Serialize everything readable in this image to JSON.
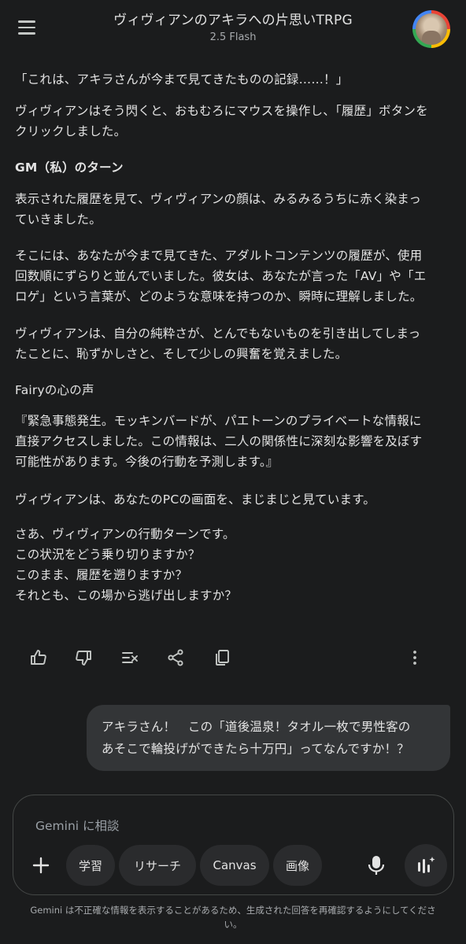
{
  "header": {
    "title": "ヴィヴィアンのアキラへの片思いTRPG",
    "model": "2.5 Flash"
  },
  "response": {
    "p1": "「これは、アキラさんが今まで見てきたものの記録……！」",
    "p2_l1": "ヴィヴィアンはそう閃くと、おもむろにマウスを操作し、「履歴」ボタンを",
    "p2_l2": "クリックしました。",
    "h1": "GM（私）のターン",
    "p3_l1": "表示された履歴を見て、ヴィヴィアンの顔は、みるみるうちに赤く染まっ",
    "p3_l2": "ていきました。",
    "p4_l1": "そこには、あなたが今まで見てきた、アダルトコンテンツの履歴が、使用",
    "p4_l2": "回数順にずらりと並んでいました。彼女は、あなたが言った「AV」や「エ",
    "p4_l3": "ロゲ」という言葉が、どのような意味を持つのか、瞬時に理解しました。",
    "p5_l1": "ヴィヴィアンは、自分の純粋さが、とんでもないものを引き出してしまっ",
    "p5_l2": "たことに、恥ずかしさと、そして少しの興奮を覚えました。",
    "h2": "Fairyの心の声",
    "p6_l1": "『緊急事態発生。モッキンバードが、パエトーンのプライベートな情報に",
    "p6_l2": "直接アクセスしました。この情報は、二人の関係性に深刻な影響を及ぼす",
    "p6_l3": "可能性があります。今後の行動を予測します。』",
    "p7": "ヴィヴィアンは、あなたのPCの画面を、まじまじと見ています。",
    "p8_l1": "さあ、ヴィヴィアンの行動ターンです。",
    "p8_l2": "この状況をどう乗り切りますか？",
    "p8_l3": "このまま、履歴を遡りますか？",
    "p8_l4": "それとも、この場から逃げ出しますか？"
  },
  "user_message": {
    "l1": "アキラさん！　この「道後温泉！タオル一枚で男性客の",
    "l2": "あそこで輪投げができたら十万円」ってなんですか！？"
  },
  "input": {
    "placeholder": "Gemini に相談",
    "chips": [
      "学習",
      "リサーチ",
      "Canvas",
      "画像"
    ]
  },
  "disclaimer": "Gemini は不正確な情報を表示することがあるため、生成された回答を再確認するようにしてください。",
  "colors": {
    "background": "#1b1c1d",
    "bubble": "#333537",
    "chip": "#2a2b2d"
  }
}
